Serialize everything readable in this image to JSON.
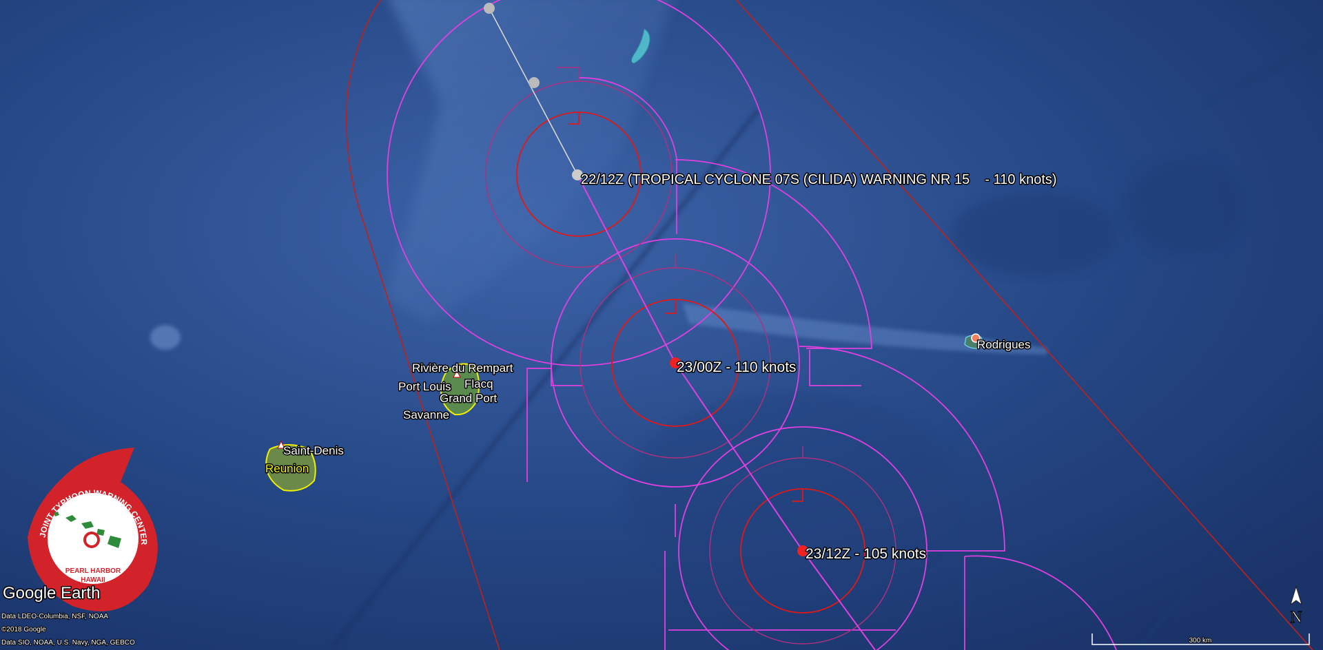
{
  "map": {
    "places": {
      "riviere": "Rivière du Rempart",
      "flacq": "Flacq",
      "port_louis": "Port Louis",
      "grand_port": "Grand Port",
      "savanne": "Savanne",
      "saint_denis": "Saint-Denis",
      "reunion": "Reunion",
      "rodrigues": "Rodrigues"
    },
    "track": {
      "current": "22/12Z (TROPICAL CYCLONE 07S (CILIDA) WARNING NR 15    - 110 knots)",
      "f1": "23/00Z - 110 knots",
      "f2": "23/12Z - 105 knots"
    },
    "scale_label": "300 km",
    "north_label": "N",
    "branding": "Google Earth",
    "attributions": {
      "line1": "Data LDEO-Columbia, NSF, NOAA",
      "line2": "©2018 Google",
      "line3": "Data SIO, NOAA, U.S. Navy, NGA, GEBCO"
    },
    "logo": {
      "ring_text": "JOINT TYPHOON WARNING CENTER",
      "line1": "PEARL HARBOR",
      "line2": "HAWAII"
    },
    "colors": {
      "ocean": "#2a4a8c",
      "danger_swath": "#c0201c",
      "wind_34kt": "#e040e0",
      "wind_50kt": "#b03080",
      "wind_64kt": "#e01818",
      "track_past": "#dddddd",
      "track_forecast": "#e040e0",
      "jtwc_red": "#d2232a"
    }
  }
}
